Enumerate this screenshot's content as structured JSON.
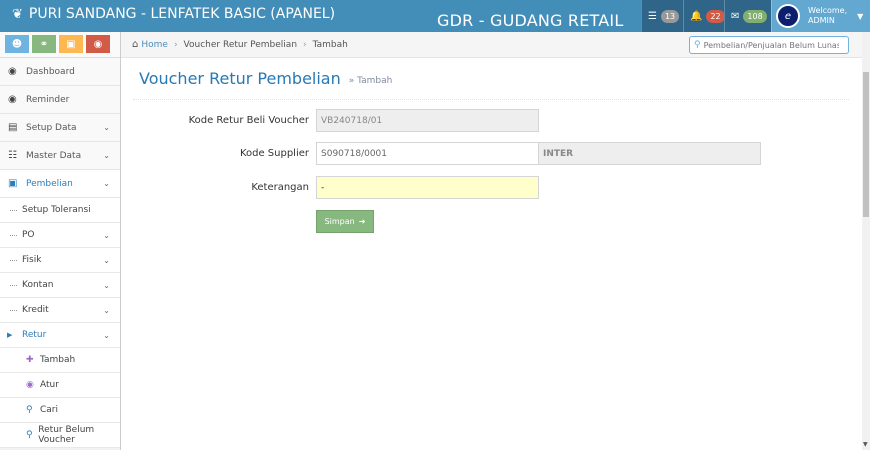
{
  "navbar": {
    "brand": "PURI SANDANG - LENFATEK BASIC (APANEL)",
    "center_title": "GDR - GUDANG RETAIL",
    "tasks_count": "13",
    "notif_count": "22",
    "msgs_count": "108",
    "user_welcome": "Welcome,",
    "user_name": "ADMIN",
    "avatar_letter": "e"
  },
  "sidebar": {
    "items": [
      {
        "label": "Dashboard",
        "icon": "tachometer-icon"
      },
      {
        "label": "Reminder",
        "icon": "reminder-icon"
      },
      {
        "label": "Setup Data",
        "icon": "clipboard-icon"
      },
      {
        "label": "Master Data",
        "icon": "database-icon"
      },
      {
        "label": "Pembelian",
        "icon": "basket-icon"
      }
    ],
    "pembelian_sub": [
      {
        "label": "Setup Toleransi"
      },
      {
        "label": "PO"
      },
      {
        "label": "Fisik"
      },
      {
        "label": "Kontan"
      },
      {
        "label": "Kredit"
      },
      {
        "label": "Retur"
      }
    ],
    "retur_sub": [
      {
        "label": "Tambah",
        "icon": "plus-icon"
      },
      {
        "label": "Atur",
        "icon": "eye-icon"
      },
      {
        "label": "Cari",
        "icon": "search-icon"
      },
      {
        "label": "Retur Belum Voucher",
        "icon": "search-icon"
      }
    ]
  },
  "breadcrumb": {
    "home": "Home",
    "level1": "Voucher Retur Pembelian",
    "level2": "Tambah"
  },
  "search": {
    "placeholder": "Pembelian/Penjualan Belum Lunas"
  },
  "header": {
    "title": "Voucher Retur Pembelian",
    "subtitle": "Tambah"
  },
  "form": {
    "kode_retur_label": "Kode Retur Beli Voucher",
    "kode_retur_value": "VB240718/01",
    "kode_supplier_label": "Kode Supplier",
    "kode_supplier_value": "S090718/0001",
    "supplier_name": "INTER",
    "keterangan_label": "Keterangan",
    "keterangan_value": "-",
    "save_label": "Simpan"
  },
  "colors": {
    "navbar": "#438eb9",
    "accent": "#2679b5",
    "save_button": "#87b87f"
  }
}
